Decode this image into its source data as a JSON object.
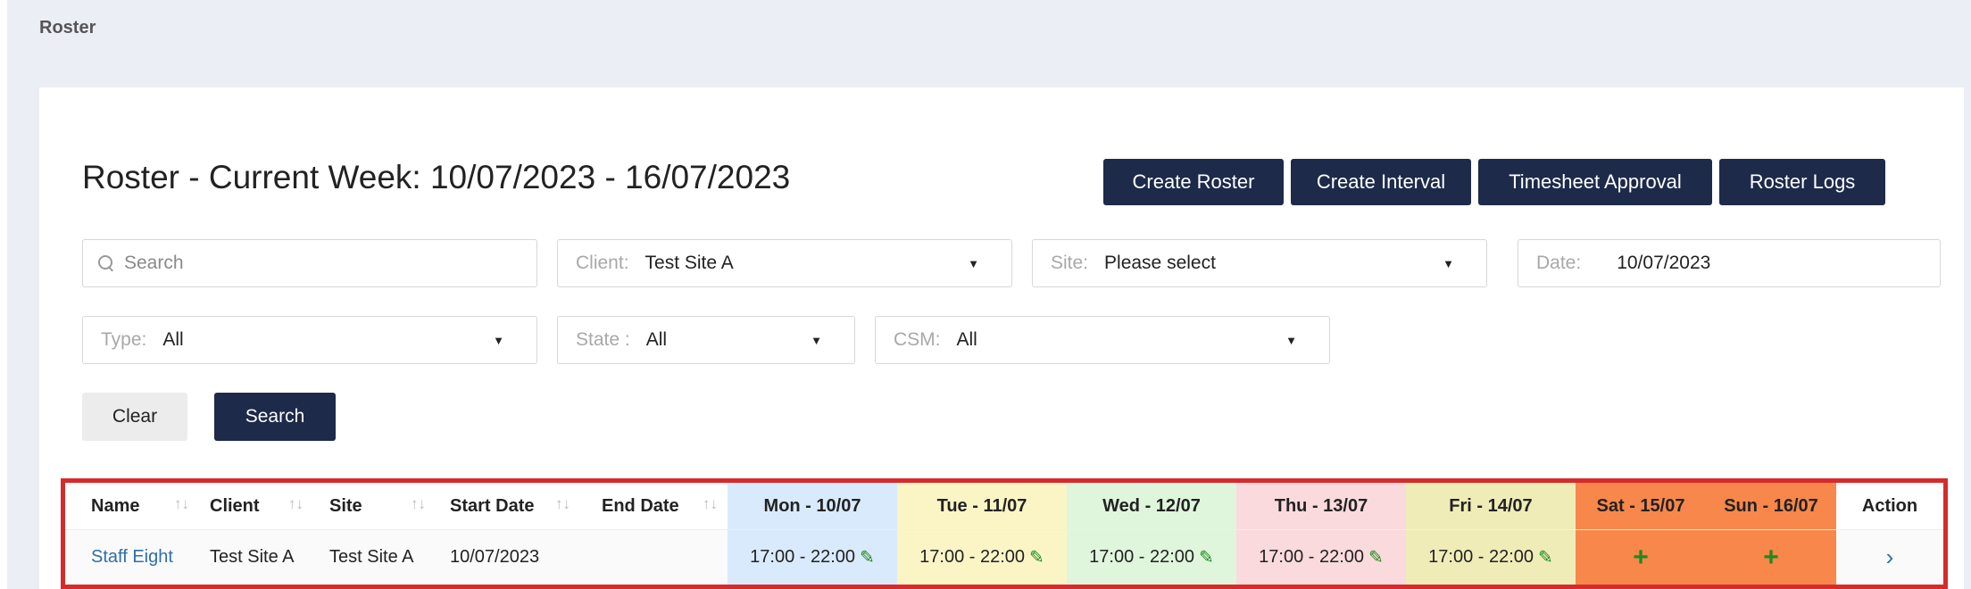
{
  "breadcrumb": "Roster",
  "page_title": "Roster - Current Week: 10/07/2023 - 16/07/2023",
  "toolbar": {
    "create_roster": "Create Roster",
    "create_interval": "Create Interval",
    "timesheet_approval": "Timesheet Approval",
    "roster_logs": "Roster Logs"
  },
  "filters": {
    "search_placeholder": "Search",
    "client_label": "Client:",
    "client_value": "Test Site A",
    "site_label": "Site:",
    "site_value": "Please select",
    "date_label": "Date:",
    "date_value": "10/07/2023",
    "type_label": "Type:",
    "type_value": "All",
    "state_label": "State :",
    "state_value": "All",
    "csm_label": "CSM:",
    "csm_value": "All",
    "caret": "▼"
  },
  "actions": {
    "clear": "Clear",
    "search": "Search"
  },
  "table": {
    "headers": {
      "name": "Name",
      "client": "Client",
      "site": "Site",
      "start_date": "Start Date",
      "end_date": "End Date",
      "mon": "Mon - 10/07",
      "tue": "Tue - 11/07",
      "wed": "Wed - 12/07",
      "thu": "Thu - 13/07",
      "fri": "Fri - 14/07",
      "sat": "Sat - 15/07",
      "sun": "Sun - 16/07",
      "action": "Action"
    },
    "sort_glyph": "↑↓",
    "row": {
      "name": "Staff Eight",
      "client": "Test Site A",
      "site": "Test Site A",
      "start_date": "10/07/2023",
      "end_date": "",
      "mon": "17:00 - 22:00",
      "tue": "17:00 - 22:00",
      "wed": "17:00 - 22:00",
      "thu": "17:00 - 22:00",
      "fri": "17:00 - 22:00",
      "sat": "+",
      "sun": "+",
      "action": "›"
    },
    "colors": {
      "mon": "#d9eafc",
      "tue": "#fbf5c6",
      "wed": "#dff6dc",
      "thu": "#fadadd",
      "fri": "#f0ecb8",
      "sat": "#f7874a",
      "sun": "#f7874a",
      "highlight_border": "#d62b2b"
    }
  }
}
